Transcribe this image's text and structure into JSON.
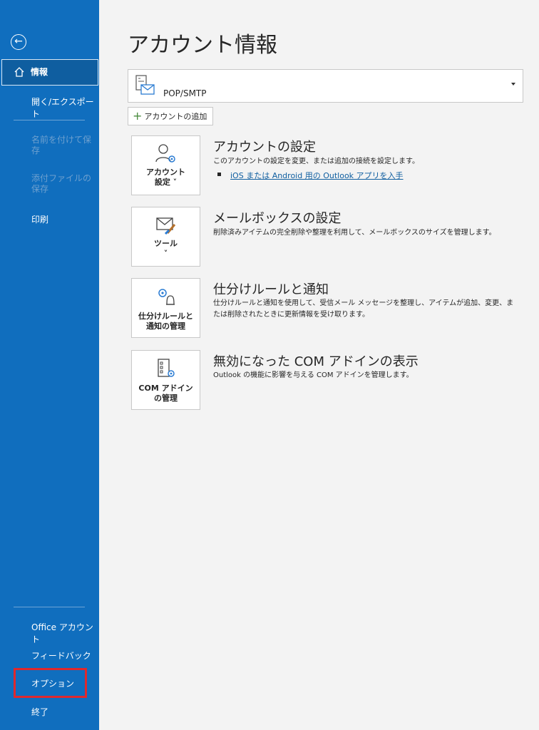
{
  "sidebar": {
    "back_icon": "back-arrow-icon",
    "items": [
      {
        "label": "情報",
        "icon": "home-icon",
        "selected": true
      },
      {
        "label": "開く/エクスポート"
      },
      {
        "label": "名前を付けて保存",
        "disabled": true
      },
      {
        "label": "添付ファイルの保存",
        "disabled": true
      },
      {
        "label": "印刷"
      }
    ],
    "bottom_items": [
      {
        "label": "Office アカウント"
      },
      {
        "label": "フィードバック"
      },
      {
        "label": "オプション",
        "highlighted": true
      },
      {
        "label": "終了"
      }
    ],
    "colors": {
      "background": "#106ebe",
      "highlight_border": "#e0282d"
    }
  },
  "main": {
    "title": "アカウント情報",
    "account": {
      "name": "POP/SMTP",
      "icon": "mail-account-icon"
    },
    "add_account_label": "アカウントの追加",
    "sections": [
      {
        "tile_label": "アカウント\n設定 ˅",
        "tile_icon": "account-settings-icon",
        "title": "アカウントの設定",
        "description": "このアカウントの設定を変更、または追加の接続を設定します。",
        "link": "iOS または Android 用の Outlook アプリを入手"
      },
      {
        "tile_label": "ツール\n˅",
        "tile_icon": "mailbox-tools-icon",
        "title": "メールボックスの設定",
        "description": "削除済みアイテムの完全削除や整理を利用して、メールボックスのサイズを管理します。"
      },
      {
        "tile_label": "仕分けルールと\n通知の管理",
        "tile_icon": "rules-alerts-icon",
        "title": "仕分けルールと通知",
        "description": "仕分けルールと通知を使用して、受信メール メッセージを整理し、アイテムが追加、変更、または削除されたときに更新情報を受け取ります。"
      },
      {
        "tile_label": "COM アドイン\nの管理",
        "tile_icon": "com-addins-icon",
        "title": "無効になった COM アドインの表示",
        "description": "Outlook の機能に影響を与える COM アドインを管理します。"
      }
    ]
  }
}
